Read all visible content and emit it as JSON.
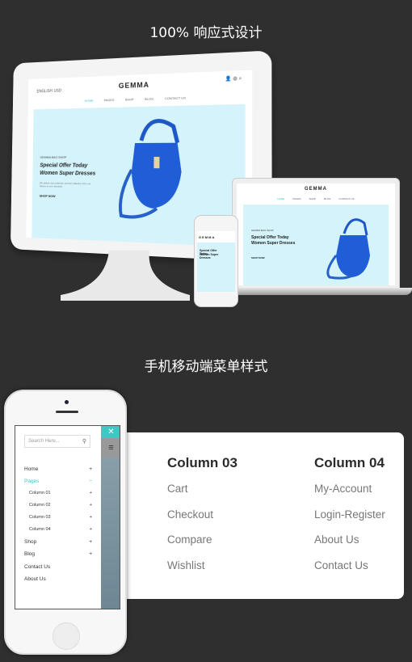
{
  "headings": {
    "responsive": "100% 响应式设计",
    "mobile_menu": "手机移动端菜单样式"
  },
  "site": {
    "logo": "GEMMA",
    "lang": "ENGLISH",
    "currency": "USD",
    "nav": [
      "HOME",
      "PAGES",
      "SHOP",
      "BLOG",
      "CONTACT US"
    ],
    "hero_tag": "GEMMA BAG SHOP",
    "hero_title_1": "Special Offer Today",
    "hero_title_2": "Women Super Dresses",
    "hero_sub": "We deliver new collection and hot collection from our factory to your doorstep",
    "shop_now": "SHOP NOW"
  },
  "mobile_menu": {
    "search_placeholder": "Search Here...",
    "items": [
      {
        "label": "Home",
        "toggle": "+"
      },
      {
        "label": "Pages",
        "toggle": "−"
      },
      {
        "label": "Column 01",
        "toggle": "+"
      },
      {
        "label": "Column 02",
        "toggle": "+"
      },
      {
        "label": "Column 03",
        "toggle": "+"
      },
      {
        "label": "Column 04",
        "toggle": "+"
      },
      {
        "label": "Shop",
        "toggle": "+"
      },
      {
        "label": "Blog",
        "toggle": "+"
      },
      {
        "label": "Contact Us",
        "toggle": ""
      },
      {
        "label": "About Us",
        "toggle": ""
      }
    ],
    "active_color": "#33cccc"
  },
  "mega_menu": {
    "columns": [
      {
        "title": "Column 03",
        "links": [
          "Cart",
          "Checkout",
          "Compare",
          "Wishlist"
        ]
      },
      {
        "title": "Column 04",
        "links": [
          "My-Account",
          "Login-Register",
          "About Us",
          "Contact Us"
        ]
      }
    ]
  }
}
